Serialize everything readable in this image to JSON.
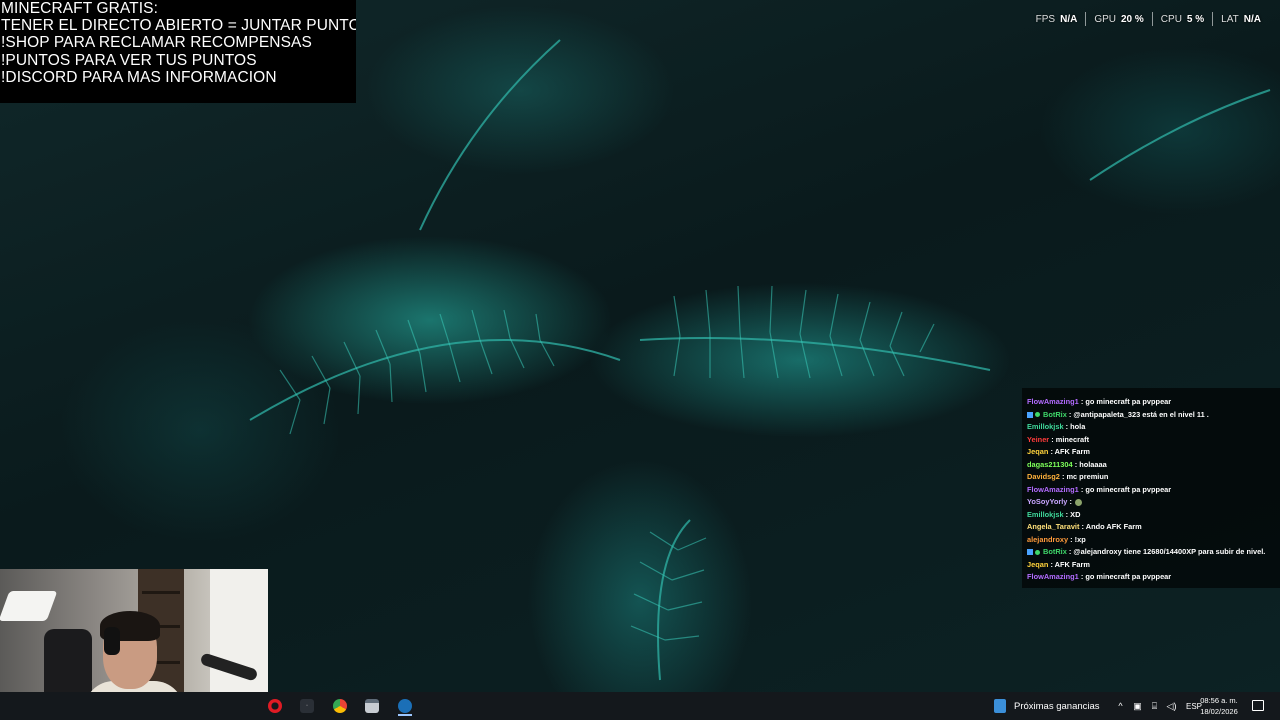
{
  "overlay": {
    "lines": [
      "MINECRAFT GRATIS:",
      "TENER EL DIRECTO ABIERTO = JUNTAR PUNTOS",
      "!SHOP PARA RECLAMAR RECOMPENSAS",
      "!PUNTOS PARA VER TUS PUNTOS",
      "!DISCORD PARA MAS INFORMACION"
    ]
  },
  "perf": {
    "fps_label": "FPS",
    "fps_value": "N/A",
    "gpu_label": "GPU",
    "gpu_value": "20 %",
    "cpu_label": "CPU",
    "cpu_value": "5 %",
    "lat_label": "LAT",
    "lat_value": "N/A"
  },
  "chat": {
    "messages": [
      {
        "user": "FlowAmazing1",
        "text": ": go minecraft pa pvppear",
        "color": "#b36bff"
      },
      {
        "user": "BotRix",
        "text": ": @antipapaleta_323 está en el nivel 11 .",
        "color": "#3fd86a",
        "badge": true
      },
      {
        "user": "Emillokjsk",
        "text": ": hola",
        "color": "#3fd89a"
      },
      {
        "user": "Yeiner",
        "text": ": minecraft",
        "color": "#ff3b3b"
      },
      {
        "user": "Jeqan",
        "text": ": AFK Farm",
        "color": "#ffd23b"
      },
      {
        "user": "dagas211304",
        "text": ": holaaaa",
        "color": "#7dff5a"
      },
      {
        "user": "Davidsg2",
        "text": ": mc premiun",
        "color": "#ffb13b"
      },
      {
        "user": "FlowAmazing1",
        "text": ": go minecraft pa pvppear",
        "color": "#b36bff"
      },
      {
        "user": "YoSoyYorly",
        "text": ":",
        "color": "#c9a6ff",
        "emote": true
      },
      {
        "user": "Emillokjsk",
        "text": ": XD",
        "color": "#3fd89a"
      },
      {
        "user": "Angela_Taravit",
        "text": ": Ando AFK Farm",
        "color": "#ffe07a"
      },
      {
        "user": "alejandroxy",
        "text": ": !xp",
        "color": "#ff9a3b"
      },
      {
        "user": "BotRix",
        "text": ": @alejandroxy tiene 12680/14400XP para subir de nivel.",
        "color": "#3fd86a",
        "badge": true
      },
      {
        "user": "Jeqan",
        "text": ": AFK Farm",
        "color": "#ffd23b"
      },
      {
        "user": "FlowAmazing1",
        "text": ": go minecraft pa pvppear",
        "color": "#b36bff"
      }
    ]
  },
  "taskbar": {
    "news_label": "Próximas ganancias",
    "language": "ESP",
    "time": "08:56 a. m.",
    "date": "18/02/2026",
    "apps": [
      "opera-icon",
      "obs-icon",
      "chrome-icon",
      "files-icon",
      "steam-icon"
    ]
  }
}
